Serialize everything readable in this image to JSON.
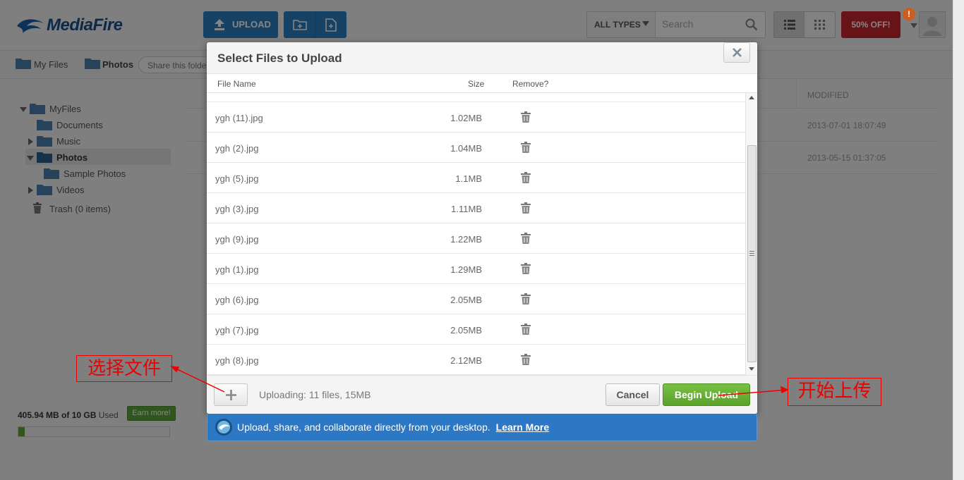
{
  "app": {
    "logo_text": "MediaFire",
    "upload_label": "UPLOAD",
    "types_label": "ALL TYPES",
    "search_placeholder": "Search",
    "promo_label": "50% OFF!",
    "notification_count": "!"
  },
  "breadcrumb": {
    "root": "My Files",
    "current": "Photos",
    "share": "Share this folder"
  },
  "tree": {
    "root": "MyFiles",
    "items": [
      "Documents",
      "Music",
      "Photos",
      "Sample Photos",
      "Videos"
    ],
    "trash": "Trash (0 items)"
  },
  "files_table": {
    "modified_header": "MODIFIED",
    "rows": [
      "2013-07-01 18:07:49",
      "2013-05-15 01:37:05"
    ]
  },
  "storage": {
    "used_amount": "405.94 MB of 10 GB",
    "used_suffix": "Used",
    "earn_label": "Earn more!",
    "used_fraction": 0.04
  },
  "modal": {
    "title": "Select Files to Upload",
    "col_name": "File Name",
    "col_size": "Size",
    "col_remove": "Remove?",
    "files": [
      {
        "name": "ygh (11).jpg",
        "size": "1.02MB"
      },
      {
        "name": "ygh (2).jpg",
        "size": "1.04MB"
      },
      {
        "name": "ygh (5).jpg",
        "size": "1.1MB"
      },
      {
        "name": "ygh (3).jpg",
        "size": "1.11MB"
      },
      {
        "name": "ygh (9).jpg",
        "size": "1.22MB"
      },
      {
        "name": "ygh (1).jpg",
        "size": "1.29MB"
      },
      {
        "name": "ygh (6).jpg",
        "size": "2.05MB"
      },
      {
        "name": "ygh (7).jpg",
        "size": "2.05MB"
      },
      {
        "name": "ygh (8).jpg",
        "size": "2.12MB"
      }
    ],
    "status": "Uploading: 11 files, 15MB",
    "cancel_label": "Cancel",
    "begin_label": "Begin Upload"
  },
  "banner": {
    "text": "Upload, share, and collaborate directly from your desktop.",
    "link": "Learn More"
  },
  "annotations": {
    "select_files": "选择文件",
    "start_upload": "开始上传",
    "color": "#e00000"
  }
}
